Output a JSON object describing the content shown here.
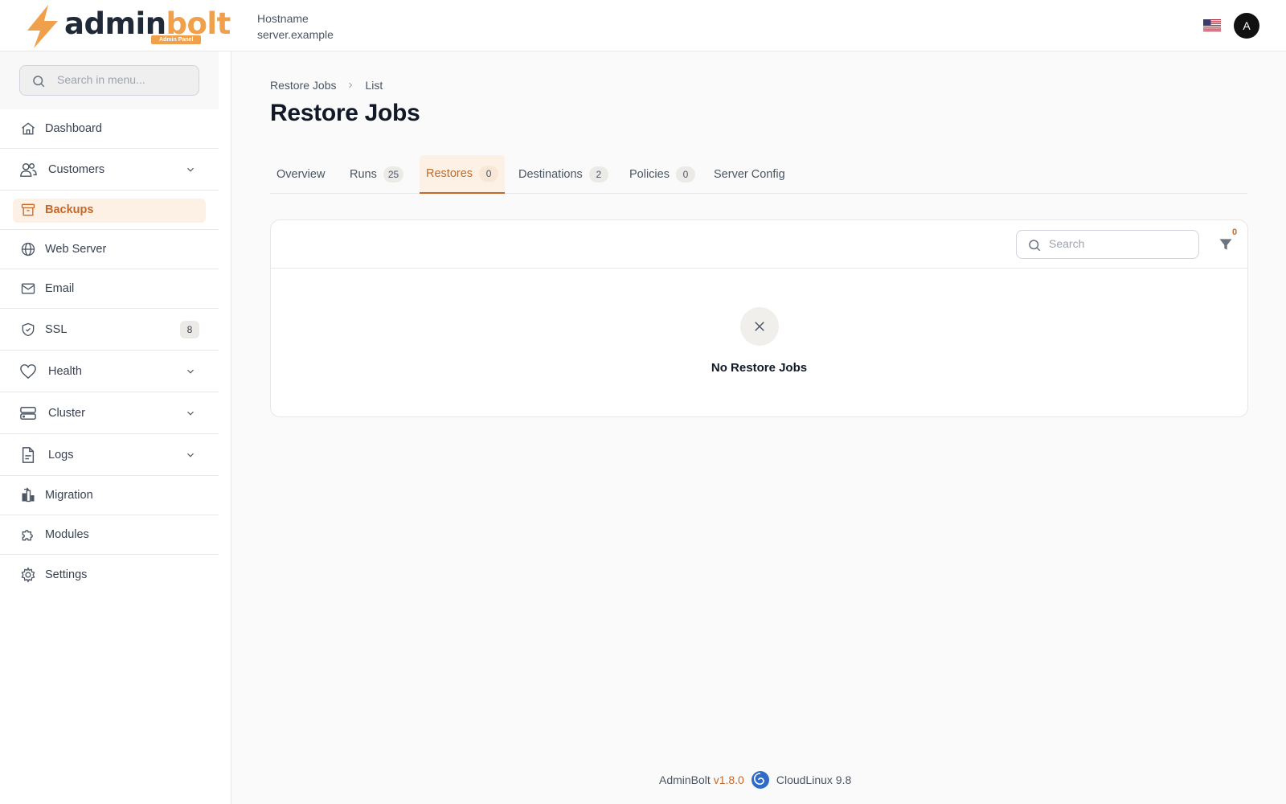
{
  "brand": {
    "name_part1": "admin",
    "name_part2": "bolt",
    "badge": "Admin Panel",
    "accent_color": "#f0a04b"
  },
  "header": {
    "hostname_label": "Hostname",
    "hostname_value": "server.example",
    "language_icon": "us-flag-icon",
    "avatar_initial": "A"
  },
  "sidebar": {
    "search_placeholder": "Search in menu...",
    "items": [
      {
        "label": "Dashboard",
        "icon": "home-icon"
      },
      {
        "label": "Customers",
        "icon": "users-icon",
        "expandable": true
      },
      {
        "label": "Backups",
        "icon": "archive-icon",
        "active": true
      },
      {
        "label": "Web Server",
        "icon": "globe-icon"
      },
      {
        "label": "Email",
        "icon": "mail-icon"
      },
      {
        "label": "SSL",
        "icon": "shield-icon",
        "badge": "8"
      },
      {
        "label": "Health",
        "icon": "heart-icon",
        "expandable": true
      },
      {
        "label": "Cluster",
        "icon": "server-icon",
        "expandable": true
      },
      {
        "label": "Logs",
        "icon": "file-icon",
        "expandable": true
      },
      {
        "label": "Migration",
        "icon": "migration-icon"
      },
      {
        "label": "Modules",
        "icon": "puzzle-icon"
      },
      {
        "label": "Settings",
        "icon": "gear-icon"
      }
    ]
  },
  "breadcrumb": {
    "parent": "Restore Jobs",
    "current": "List"
  },
  "page": {
    "title": "Restore Jobs"
  },
  "tabs": [
    {
      "label": "Overview"
    },
    {
      "label": "Runs",
      "count": "25"
    },
    {
      "label": "Restores",
      "count": "0",
      "active": true
    },
    {
      "label": "Destinations",
      "count": "2"
    },
    {
      "label": "Policies",
      "count": "0"
    },
    {
      "label": "Server Config"
    }
  ],
  "table": {
    "search_placeholder": "Search",
    "filter_count": "0",
    "empty_message": "No Restore Jobs"
  },
  "footer": {
    "product": "AdminBolt",
    "version": "v1.8.0",
    "os": "CloudLinux 9.8"
  }
}
